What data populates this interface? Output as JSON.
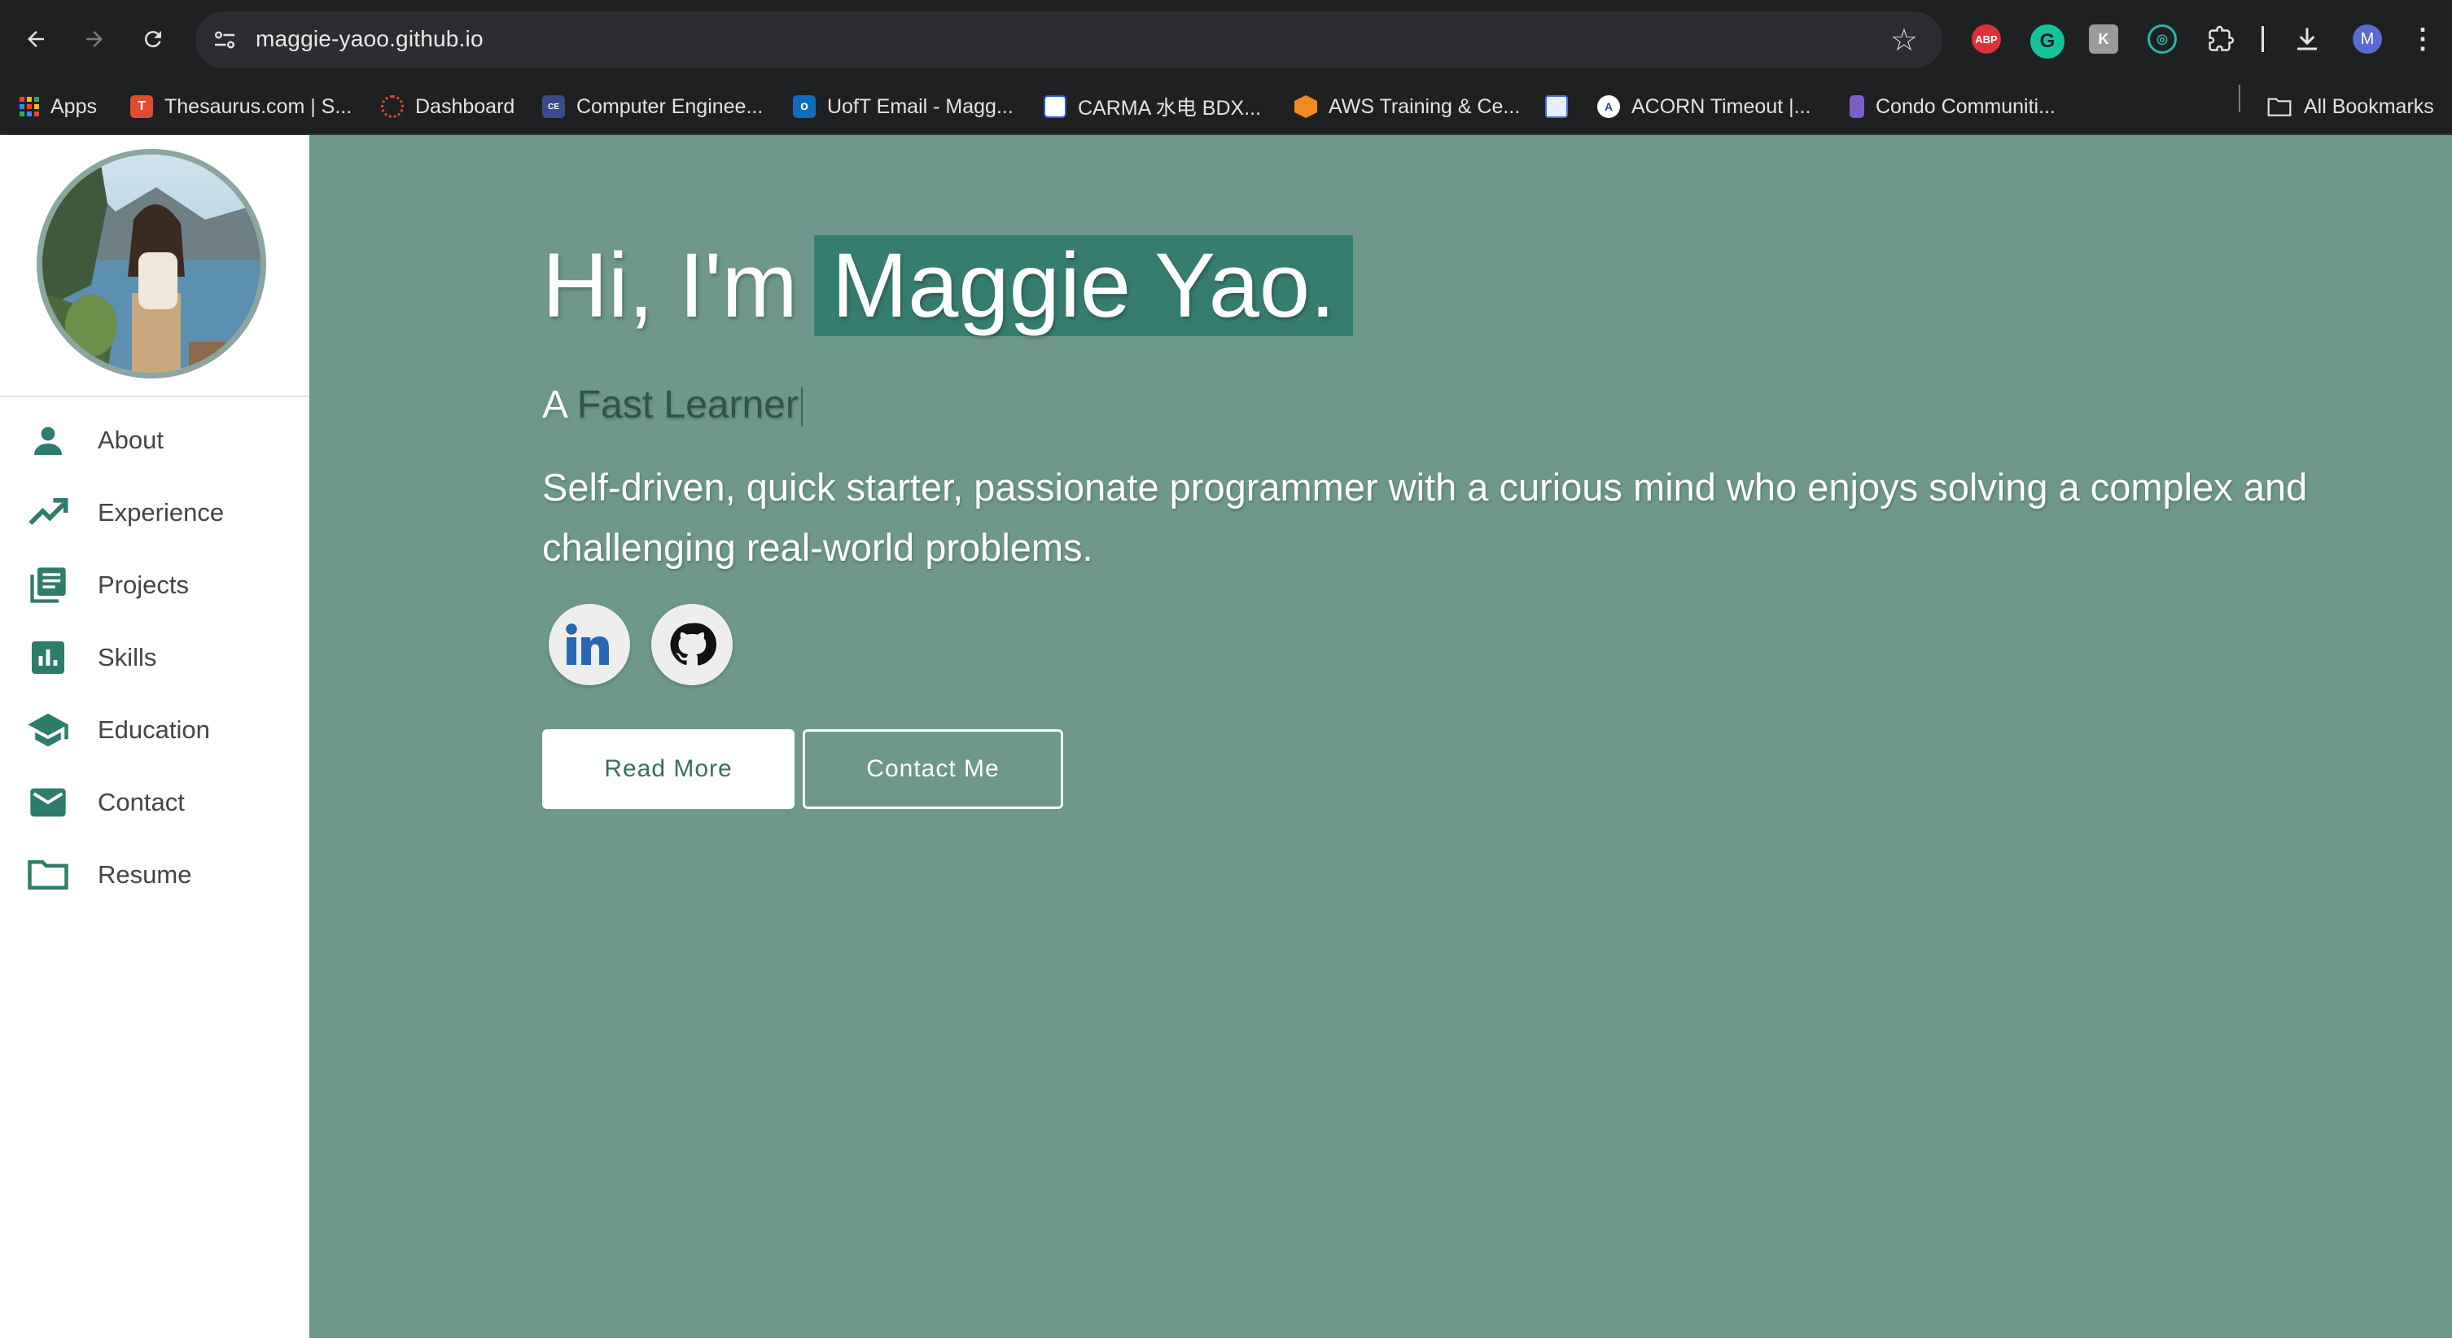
{
  "browser": {
    "url": "maggie-yaoo.github.io",
    "extensions": {
      "abp_label": "ABP",
      "profile_initial": "M"
    },
    "bookmarks": [
      {
        "label": "Apps",
        "icon": "apps-grid-icon"
      },
      {
        "label": "Thesaurus.com | S...",
        "icon": "thesaurus-icon"
      },
      {
        "label": "Dashboard",
        "icon": "dashboard-icon"
      },
      {
        "label": "Computer Enginee...",
        "icon": "computer-engineering-icon"
      },
      {
        "label": "UofT Email - Magg...",
        "icon": "outlook-icon"
      },
      {
        "label": "CARMA 水电 BDX...",
        "icon": "carma-icon"
      },
      {
        "label": "AWS Training & Ce...",
        "icon": "aws-icon"
      },
      {
        "label": "",
        "icon": "globe-site-icon"
      },
      {
        "label": "ACORN Timeout |...",
        "icon": "acorn-icon"
      },
      {
        "label": "Condo Communiti...",
        "icon": "condo-icon"
      }
    ],
    "all_bookmarks_label": "All Bookmarks"
  },
  "sidebar": {
    "items": [
      {
        "label": "About",
        "icon": "person-icon"
      },
      {
        "label": "Experience",
        "icon": "trending-up-icon"
      },
      {
        "label": "Projects",
        "icon": "library-books-icon"
      },
      {
        "label": "Skills",
        "icon": "bar-chart-icon"
      },
      {
        "label": "Education",
        "icon": "graduation-cap-icon"
      },
      {
        "label": "Contact",
        "icon": "mail-icon"
      },
      {
        "label": "Resume",
        "icon": "folder-icon"
      }
    ]
  },
  "hero": {
    "greeting": "Hi, I'm",
    "name": "Maggie Yao.",
    "subtitle_prefix": "A",
    "subtitle_typed": "Fast Learner",
    "description": "Self-driven, quick starter, passionate programmer with a curious mind who enjoys solving a complex and challenging real-world problems.",
    "read_more_label": "Read More",
    "contact_label": "Contact Me"
  },
  "colors": {
    "accent": "#377d6f",
    "background": "#6e988c",
    "sidebar_icon": "#2e7d6c"
  }
}
